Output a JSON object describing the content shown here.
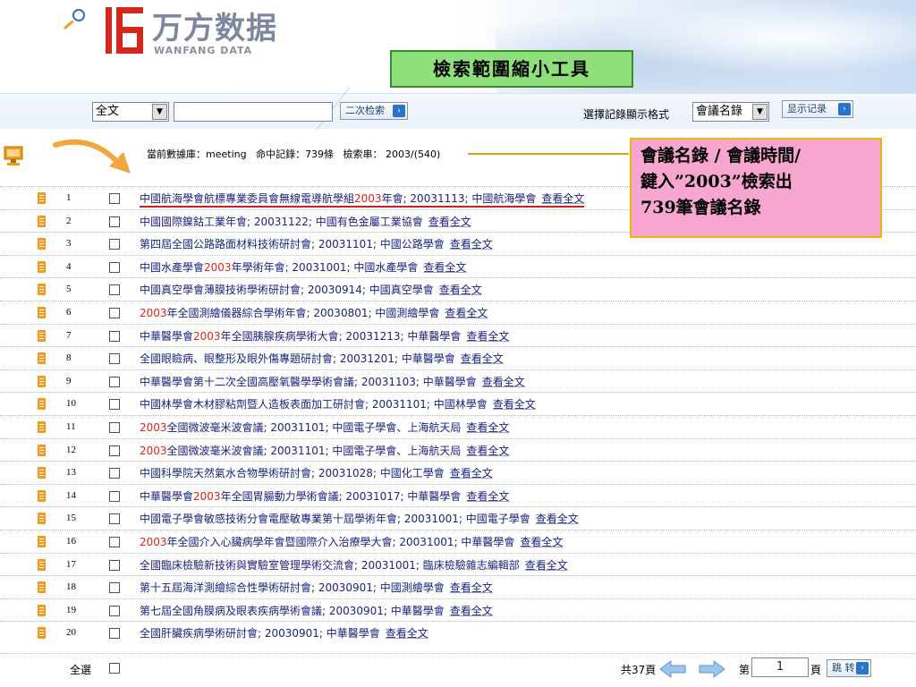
{
  "header": {
    "logo_cn": "万方数据",
    "logo_en": "WANFANG DATA",
    "callout_top": "檢索範圍縮小工具"
  },
  "search": {
    "field_select": "全文",
    "query_value": "",
    "secondary_search_button": "二次检索",
    "format_label": "選擇記錄顯示格式",
    "format_select": "會議名錄",
    "show_records_button": "显示记录"
  },
  "info": {
    "text": "當前數據庫：meeting   命中記錄：739條   檢索串： 2003/(540)"
  },
  "callout_side": {
    "lines": [
      "會議名錄 / 會議時間/",
      "鍵入”2003”檢索出",
      "739筆會議名錄"
    ]
  },
  "results": {
    "view_label": "查看全文",
    "highlight_color": "#d9261c",
    "link_color": "#1a237e",
    "rows": [
      {
        "num": "1",
        "pre": "中國航海學會航標專業委員會無線電導航學組",
        "hl": "2003",
        "post": "年會; 20031113; 中國航海學會"
      },
      {
        "num": "2",
        "pre": "中國國際鎳鈷工業年會; 20031122; 中國有色金屬工業協會",
        "hl": "",
        "post": ""
      },
      {
        "num": "3",
        "pre": "第四屆全國公路路面材料技術研討會; 20031101; 中國公路學會",
        "hl": "",
        "post": ""
      },
      {
        "num": "4",
        "pre": "中國水產學會",
        "hl": "2003",
        "post": "年學術年會; 20031001; 中國水產學會"
      },
      {
        "num": "5",
        "pre": "中國真空學會薄膜技術學術研討會; 20030914; 中國真空學會",
        "hl": "",
        "post": ""
      },
      {
        "num": "6",
        "pre": "",
        "hl": "2003",
        "post": "年全國測繪儀器綜合學術年會; 20030801; 中國測繪學會"
      },
      {
        "num": "7",
        "pre": "中華醫學會",
        "hl": "2003",
        "post": "年全國胰腺疾病學術大會; 20031213; 中華醫學會"
      },
      {
        "num": "8",
        "pre": "全國眼瞼病、眼整形及眼外傷專題研討會; 20031201; 中華醫學會",
        "hl": "",
        "post": ""
      },
      {
        "num": "9",
        "pre": "中華醫學會第十二次全國高壓氧醫學學術會議; 20031103; 中華醫學會",
        "hl": "",
        "post": ""
      },
      {
        "num": "10",
        "pre": "中國林學會木材膠粘劑暨人造板表面加工研討會; 20031101; 中國林學會",
        "hl": "",
        "post": ""
      },
      {
        "num": "11",
        "pre": "",
        "hl": "2003",
        "post": "全國微波毫米波會議; 20031101; 中國電子學會、上海航天局"
      },
      {
        "num": "12",
        "pre": "",
        "hl": "2003",
        "post": "全國微波毫米波會議; 20031101; 中國電子學會、上海航天局"
      },
      {
        "num": "13",
        "pre": "中國科學院天然氣水合物學術研討會; 20031028; 中國化工學會",
        "hl": "",
        "post": ""
      },
      {
        "num": "14",
        "pre": "中華醫學會",
        "hl": "2003",
        "post": "年全國胃腸動力學術會議; 20031017; 中華醫學會"
      },
      {
        "num": "15",
        "pre": "中國電子學會敏感技術分會電壓敏專業第十屆學術年會; 20031001; 中國電子學會",
        "hl": "",
        "post": ""
      },
      {
        "num": "16",
        "pre": "",
        "hl": "2003",
        "post": "年全國介入心臟病學年會暨國際介入治療學大會; 20031001; 中華醫學會"
      },
      {
        "num": "17",
        "pre": "全國臨床檢驗新技術與實驗室管理學術交流會; 20031001; 臨床檢驗雜志編輯部",
        "hl": "",
        "post": ""
      },
      {
        "num": "18",
        "pre": "第十五屆海洋測繪綜合性學術研討會; 20030901; 中國測繪學會",
        "hl": "",
        "post": ""
      },
      {
        "num": "19",
        "pre": "第七屆全國角膜病及眼表疾病學術會議; 20030901; 中華醫學會",
        "hl": "",
        "post": ""
      },
      {
        "num": "20",
        "pre": "全國肝臟疾病學術研討會; 20030901; 中華醫學會",
        "hl": "",
        "post": ""
      }
    ]
  },
  "footer": {
    "select_all": "全選",
    "total_pages": "共37頁",
    "page_prefix": "第",
    "page_value": "1",
    "page_suffix": "頁",
    "jump_button": "跳 转"
  }
}
